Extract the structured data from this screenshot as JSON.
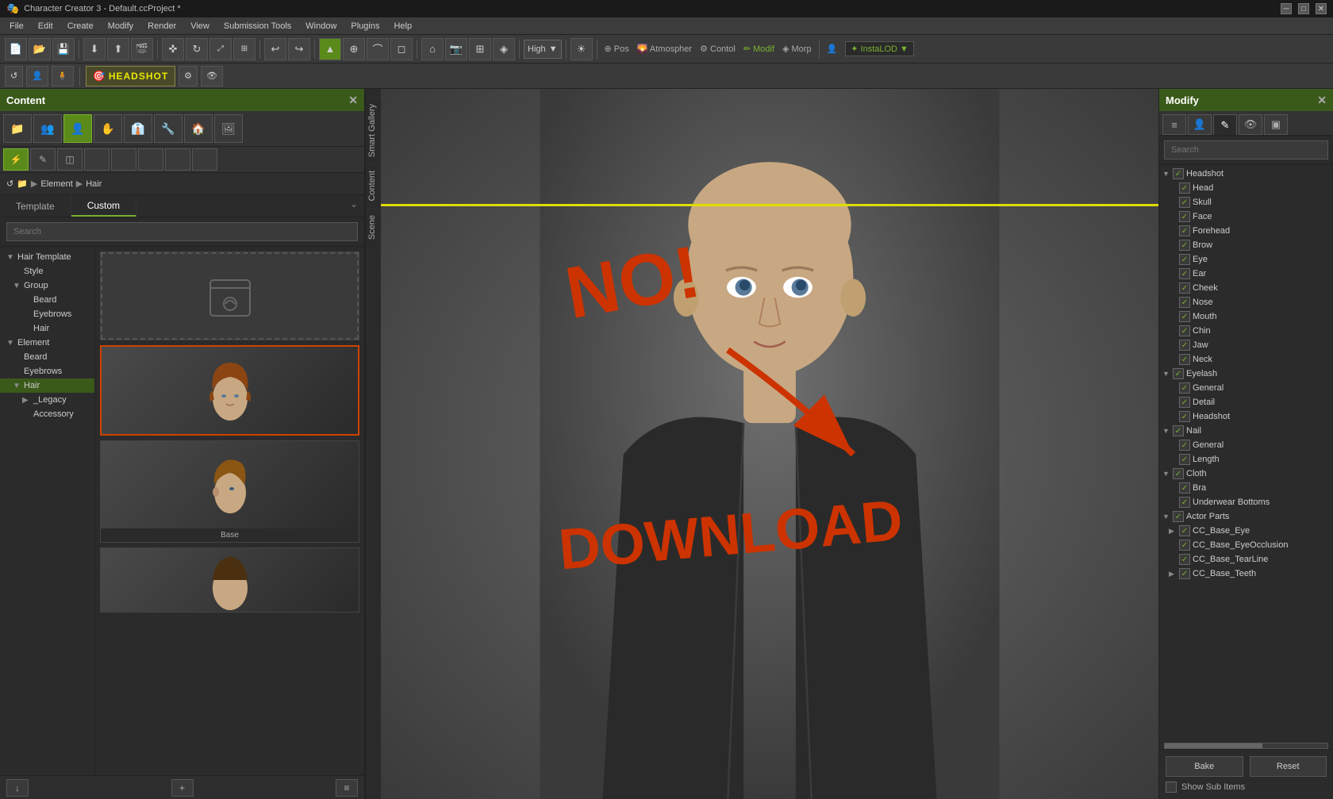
{
  "window": {
    "title": "Character Creator 3 - Default.ccProject *",
    "close": "✕",
    "maximize": "□",
    "minimize": "─"
  },
  "menubar": {
    "items": [
      "File",
      "Edit",
      "Create",
      "Modify",
      "Render",
      "View",
      "Submission Tools",
      "Window",
      "Plugins",
      "Help"
    ]
  },
  "toolbar": {
    "quality_label": "High",
    "buttons": [
      "new",
      "open",
      "save",
      "import",
      "export",
      "render"
    ],
    "mode_items": [
      "Pos",
      "Atmospher",
      "Contol",
      "Modif",
      "Morp"
    ]
  },
  "toolbar2": {
    "headshot_label": "HEADSHOT"
  },
  "content_panel": {
    "title": "Content",
    "tabs": {
      "template": "Template",
      "custom": "Custom"
    },
    "search_placeholder": "Search",
    "breadcrumb": [
      "Element",
      "Hair"
    ],
    "tree": {
      "items": [
        {
          "label": "Hair Template",
          "level": 0,
          "arrow": "open"
        },
        {
          "label": "Style",
          "level": 1,
          "arrow": "leaf"
        },
        {
          "label": "Group",
          "level": 1,
          "arrow": "open"
        },
        {
          "label": "Beard",
          "level": 2,
          "arrow": "leaf"
        },
        {
          "label": "Eyebrows",
          "level": 2,
          "arrow": "leaf"
        },
        {
          "label": "Hair",
          "level": 2,
          "arrow": "leaf"
        },
        {
          "label": "Element",
          "level": 0,
          "arrow": "open"
        },
        {
          "label": "Beard",
          "level": 1,
          "arrow": "leaf"
        },
        {
          "label": "Eyebrows",
          "level": 1,
          "arrow": "leaf"
        },
        {
          "label": "Hair",
          "level": 1,
          "arrow": "open",
          "selected": true
        },
        {
          "label": "Accessory",
          "level": 2,
          "arrow": "leaf"
        },
        {
          "label": "_Legacy",
          "level": 2,
          "arrow": "closed"
        }
      ]
    },
    "grid_items": [
      {
        "label": "",
        "free": false,
        "empty": true
      },
      {
        "label": "",
        "free": true,
        "highlighted": true
      },
      {
        "label": "Base",
        "free": true
      },
      {
        "label": "",
        "free": true,
        "partial": true
      }
    ]
  },
  "modify_panel": {
    "title": "Modify",
    "search_placeholder": "Search",
    "tree": [
      {
        "label": "Headshot",
        "level": 0,
        "arrow": "open",
        "checked": true
      },
      {
        "label": "Head",
        "level": 1,
        "arrow": "leaf",
        "checked": true
      },
      {
        "label": "Skull",
        "level": 1,
        "arrow": "leaf",
        "checked": true
      },
      {
        "label": "Face",
        "level": 1,
        "arrow": "leaf",
        "checked": true
      },
      {
        "label": "Forehead",
        "level": 1,
        "arrow": "leaf",
        "checked": true
      },
      {
        "label": "Brow",
        "level": 1,
        "arrow": "leaf",
        "checked": true
      },
      {
        "label": "Eye",
        "level": 1,
        "arrow": "leaf",
        "checked": true
      },
      {
        "label": "Ear",
        "level": 1,
        "arrow": "leaf",
        "checked": true
      },
      {
        "label": "Cheek",
        "level": 1,
        "arrow": "leaf",
        "checked": true
      },
      {
        "label": "Nose",
        "level": 1,
        "arrow": "leaf",
        "checked": true
      },
      {
        "label": "Mouth",
        "level": 1,
        "arrow": "leaf",
        "checked": true
      },
      {
        "label": "Chin",
        "level": 1,
        "arrow": "leaf",
        "checked": true
      },
      {
        "label": "Jaw",
        "level": 1,
        "arrow": "leaf",
        "checked": true
      },
      {
        "label": "Neck",
        "level": 1,
        "arrow": "leaf",
        "checked": true
      },
      {
        "label": "Eyelash",
        "level": 0,
        "arrow": "open",
        "checked": true
      },
      {
        "label": "General",
        "level": 1,
        "arrow": "leaf",
        "checked": true
      },
      {
        "label": "Detail",
        "level": 1,
        "arrow": "leaf",
        "checked": true
      },
      {
        "label": "Headshot",
        "level": 1,
        "arrow": "leaf",
        "checked": true
      },
      {
        "label": "Nail",
        "level": 0,
        "arrow": "open",
        "checked": true
      },
      {
        "label": "General",
        "level": 1,
        "arrow": "leaf",
        "checked": true
      },
      {
        "label": "Length",
        "level": 1,
        "arrow": "leaf",
        "checked": true
      },
      {
        "label": "Cloth",
        "level": 0,
        "arrow": "open",
        "checked": true
      },
      {
        "label": "Bra",
        "level": 1,
        "arrow": "leaf",
        "checked": true
      },
      {
        "label": "Underwear Bottoms",
        "level": 1,
        "arrow": "leaf",
        "checked": true
      },
      {
        "label": "Actor Parts",
        "level": 0,
        "arrow": "open",
        "checked": true
      },
      {
        "label": "CC_Base_Eye",
        "level": 1,
        "arrow": "closed",
        "checked": true
      },
      {
        "label": "CC_Base_EyeOcclusion",
        "level": 1,
        "arrow": "leaf",
        "checked": true
      },
      {
        "label": "CC_Base_TearLine",
        "level": 1,
        "arrow": "leaf",
        "checked": true
      },
      {
        "label": "CC_Base_Teeth",
        "level": 1,
        "arrow": "closed",
        "checked": true
      }
    ],
    "buttons": {
      "bake": "Bake",
      "reset": "Reset"
    },
    "show_sub_items": "Show Sub Items"
  },
  "annotations": {
    "no_download_text": "NO! DOWNLOAD",
    "circled_item": "hair item circled in red"
  },
  "side_tabs": [
    "Smart Gallery",
    "Content",
    "Scene"
  ],
  "viewport": {
    "yellow_line_visible": true
  }
}
